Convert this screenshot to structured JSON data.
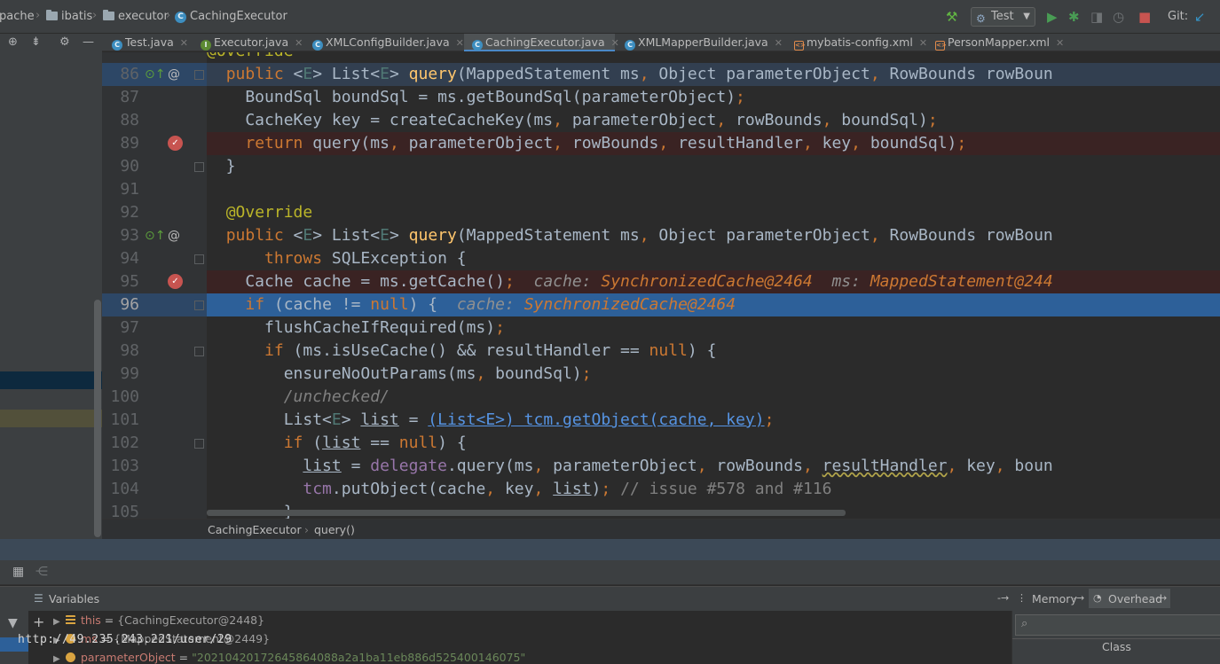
{
  "breadcrumb": {
    "items": [
      "pache",
      "ibatis",
      "executor",
      "CachingExecutor"
    ]
  },
  "toolbar": {
    "run_config": "Test",
    "git_label": "Git:"
  },
  "tabs": [
    {
      "label": "Test.java",
      "icon": "class-icon-test"
    },
    {
      "label": "Executor.java",
      "icon": "interface-icon"
    },
    {
      "label": "XMLConfigBuilder.java",
      "icon": "class-icon"
    },
    {
      "label": "CachingExecutor.java",
      "icon": "class-icon",
      "active": true
    },
    {
      "label": "XMLMapperBuilder.java",
      "icon": "class-icon"
    },
    {
      "label": "mybatis-config.xml",
      "icon": "xml-icon"
    },
    {
      "label": "PersonMapper.xml",
      "icon": "xml-icon"
    }
  ],
  "editor": {
    "line_numbers": [
      "86",
      "87",
      "88",
      "89",
      "90",
      "91",
      "92",
      "93",
      "94",
      "95",
      "96",
      "97",
      "98",
      "99",
      "100",
      "101",
      "102",
      "103",
      "104",
      "105"
    ],
    "partial_top": "@Override",
    "current_line": "96",
    "inline_values": {
      "line95_a_label": "cache:",
      "line95_a_value": "SynchronizedCache@2464",
      "line95_b_label": "ms:",
      "line95_b_value": "MappedStatement@244",
      "line96_label": "cache:",
      "line96_value": "SynchronizedCache@2464"
    }
  },
  "editor_breadcrumb": {
    "class": "CachingExecutor",
    "method": "query()"
  },
  "debug": {
    "variables_title": "Variables",
    "memory_tab": "Memory",
    "overhead_tab": "Overhead",
    "memory_column": "Class",
    "rows": [
      {
        "name": "this",
        "value": "{CachingExecutor@2448}"
      },
      {
        "name": "ms",
        "value": "{MappedStatement@2449}"
      },
      {
        "name": "parameterObject",
        "value": "\"20210420172645864088a2a1ba11eb886d525400146075\""
      }
    ],
    "watermark": "http://49.235.243.221/user/29"
  },
  "colors": {
    "exec_line": "#2d6099",
    "breakpoint": "#c75450",
    "keyword": "#cc7832",
    "function": "#ffc66d"
  }
}
